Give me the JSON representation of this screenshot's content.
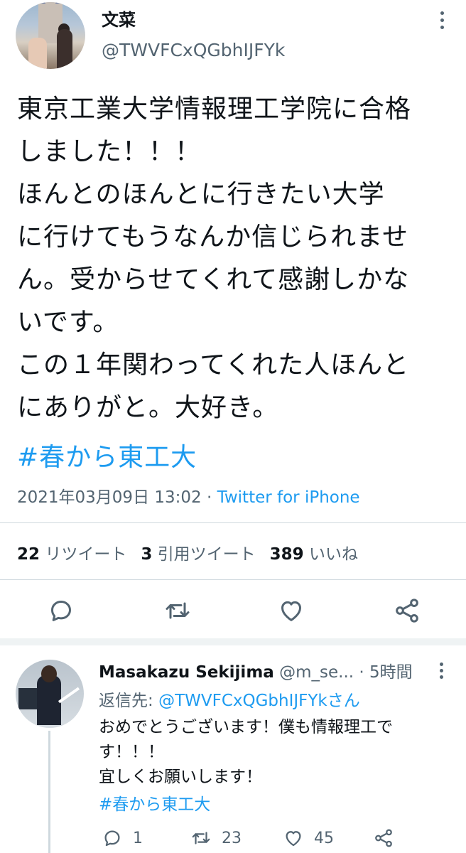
{
  "main_tweet": {
    "display_name": "文菜",
    "handle": "@TWVFCxQGbhIJFYk",
    "text_lines": [
      "東京工業大学情報理工学院に合格",
      "しました！！！",
      "ほんとのほんとに行きたい大学",
      "に行けてもうなんか信じられませ",
      "ん。受からせてくれて感謝しかな",
      "いです。",
      "この１年関わってくれた人ほんと",
      "にありがと。大好き。"
    ],
    "hashtag": "#春から東工大",
    "timestamp": "2021年03月09日 13:02",
    "separator": " · ",
    "source": "Twitter for iPhone",
    "stats": {
      "retweets_count": "22",
      "retweets_label": "リツイート",
      "quotes_count": "3",
      "quotes_label": "引用ツイート",
      "likes_count": "389",
      "likes_label": "いいね"
    },
    "icons": [
      "reply-icon",
      "retweet-icon",
      "like-icon",
      "share-icon"
    ]
  },
  "reply_tweet": {
    "display_name": "Masakazu Sekijima",
    "handle": "@m_se...",
    "time": " · 5時間",
    "reply_to_label": "返信先: ",
    "reply_to_mention": "@TWVFCxQGbhIJFYkさん",
    "text_lines": [
      "おめでとうございます！僕も情報理工で",
      "す！！！",
      "宜しくお願いします！"
    ],
    "hashtag": "#春から東工大",
    "replies_count": "1",
    "retweets_count": "23",
    "likes_count": "45"
  },
  "colors": {
    "accent": "#1d9bf0",
    "secondary_text": "#536471",
    "divider": "#cfd9de"
  }
}
